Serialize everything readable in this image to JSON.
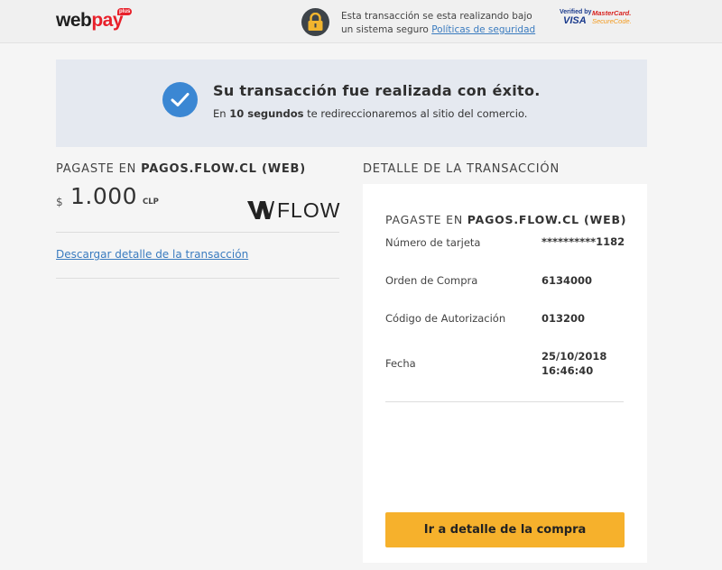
{
  "header": {
    "logo": {
      "part1": "web",
      "part2": "pay",
      "badge": "plus"
    },
    "lock_icon": "lock-icon",
    "secure_text": "Esta transacción se esta realizando bajo un sistema seguro",
    "policy_link": "Políticas de seguridad",
    "card_logos": {
      "verified_by": "Verified by",
      "visa": "VISA",
      "mastercard": "MasterCard.",
      "securecode": "SecureCode."
    }
  },
  "banner": {
    "icon": "check-circle-icon",
    "title": "Su transacción fue realizada con éxito.",
    "sub_prefix": "En",
    "sub_bold": "10 segundos",
    "sub_suffix": "te redireccionaremos al sitio del comercio."
  },
  "payment": {
    "heading_prefix": "PAGASTE EN",
    "heading_merchant": "PAGOS.FLOW.CL (WEB)",
    "currency_symbol": "$",
    "amount": "1.000",
    "currency_code": "CLP",
    "merchant_logo_text": "FLOW",
    "download_link": "Descargar detalle de la transacción"
  },
  "detail": {
    "heading": "DETALLE DE LA TRANSACCIÓN",
    "panel_heading_prefix": "PAGASTE EN",
    "panel_heading_merchant": "PAGOS.FLOW.CL (WEB)",
    "rows": [
      {
        "label": "Número de tarjeta",
        "value": "**********1182"
      },
      {
        "label": "Orden de Compra",
        "value": "6134000"
      },
      {
        "label": "Código de Autorización",
        "value": "013200"
      },
      {
        "label": "Fecha",
        "value_line1": "25/10/2018",
        "value_line2": "16:46:40"
      }
    ],
    "cta_label": "Ir a detalle de la compra"
  },
  "colors": {
    "accent_blue": "#3b87d3",
    "link_blue": "#3a7bbf",
    "cta_yellow": "#f6b12c",
    "brand_red": "#e8202a"
  }
}
